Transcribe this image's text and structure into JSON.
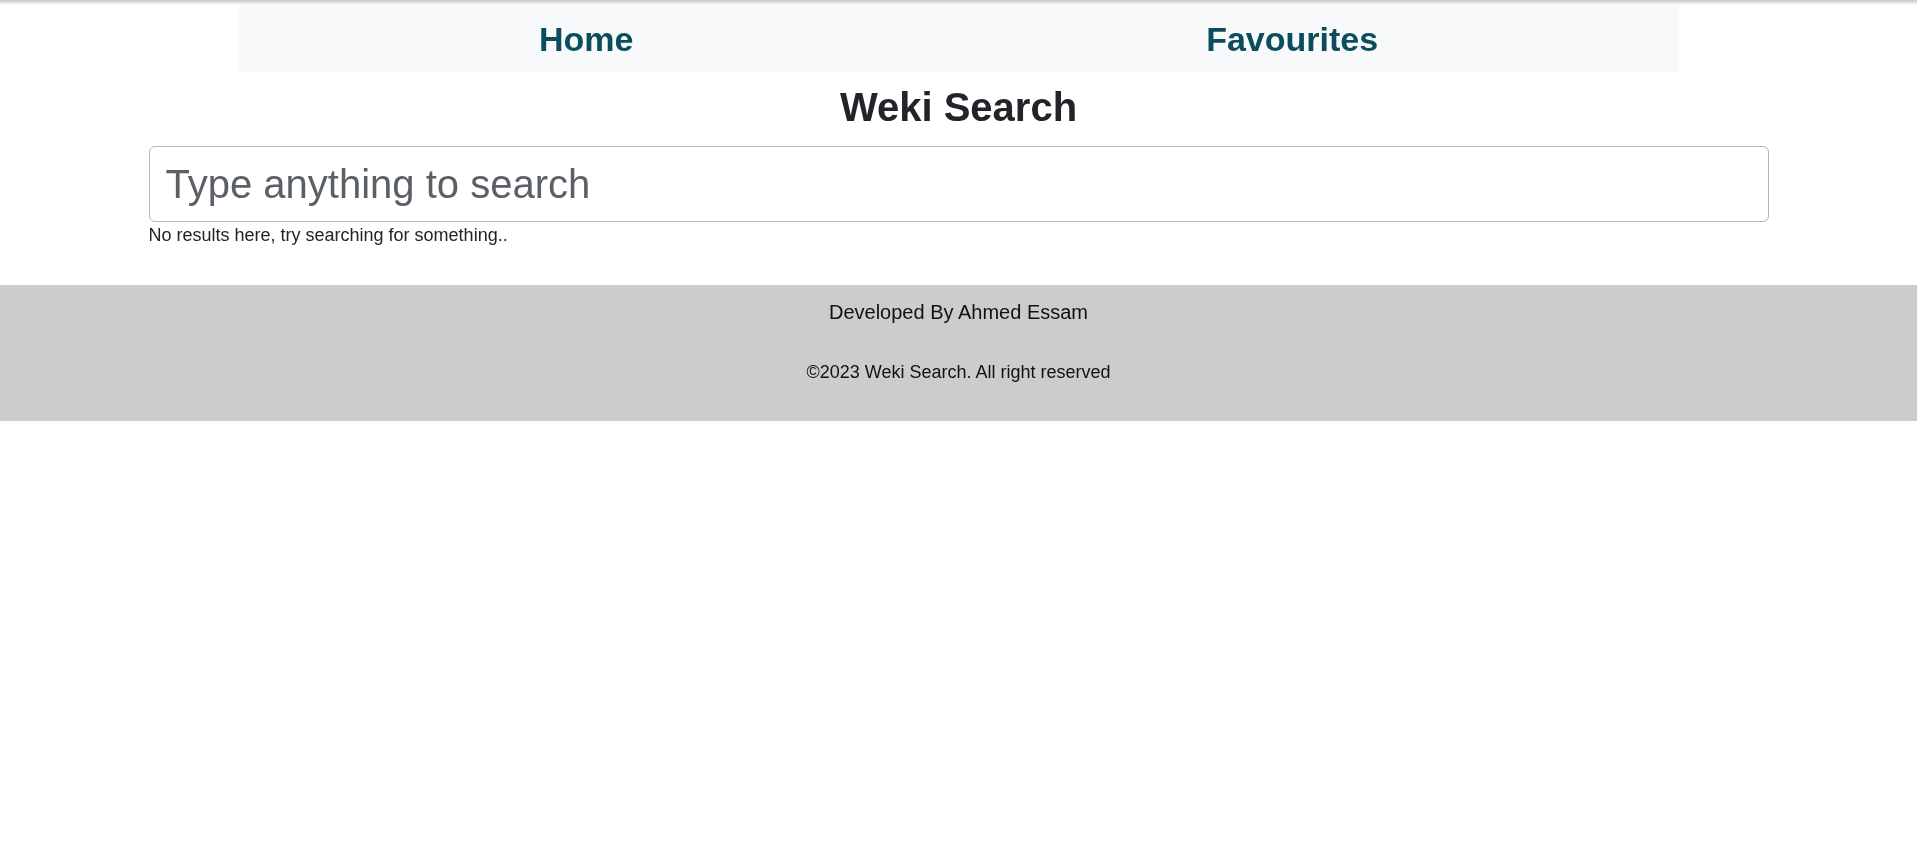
{
  "nav": {
    "links": [
      {
        "label": "Home"
      },
      {
        "label": "Favourites"
      }
    ]
  },
  "title": "Weki Search",
  "search": {
    "placeholder": "Type anything to search"
  },
  "results": {
    "message": "No results here, try searching for something.."
  },
  "footer": {
    "credit": "Developed By Ahmed Essam",
    "copyright": "©2023 Weki Search. All right reserved"
  }
}
